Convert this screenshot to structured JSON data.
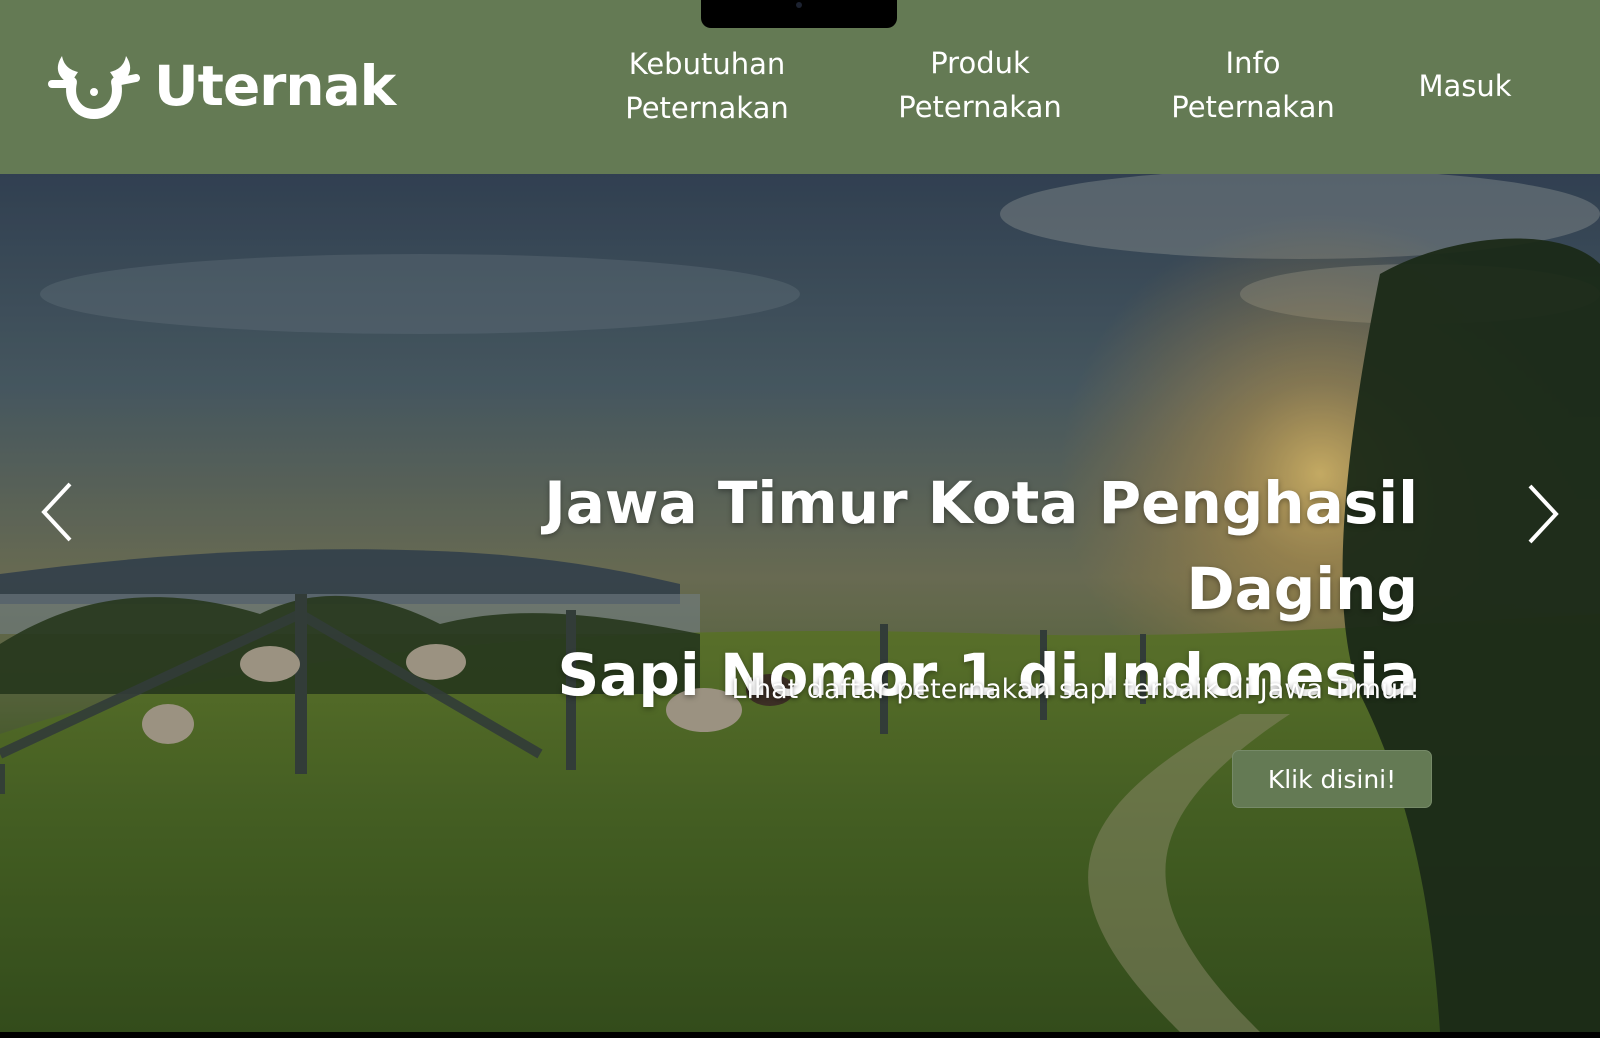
{
  "brand": {
    "name": "Uternak",
    "logo_icon": "bull-horns-icon"
  },
  "nav": {
    "kebutuhan": {
      "line1": "Kebutuhan",
      "line2": "Peternakan"
    },
    "produk": {
      "line1": "Produk",
      "line2": "Peternakan"
    },
    "info": {
      "line1": "Info",
      "line2": "Peternakan"
    },
    "masuk": "Masuk"
  },
  "hero": {
    "title_line1": "Jawa Timur Kota Penghasil Daging",
    "title_line2": "Sapi Nomor 1 di Indonesia",
    "subtitle": "Lihat daftar peternakan sapi terbaik di Jawa Timur!",
    "cta_label": "Klik disini!",
    "prev_icon": "chevron-left-icon",
    "next_icon": "chevron-right-icon",
    "image": "pasture-sunset-sheep-photo"
  },
  "colors": {
    "primary_green": "#647a54",
    "text_white": "#ffffff"
  }
}
